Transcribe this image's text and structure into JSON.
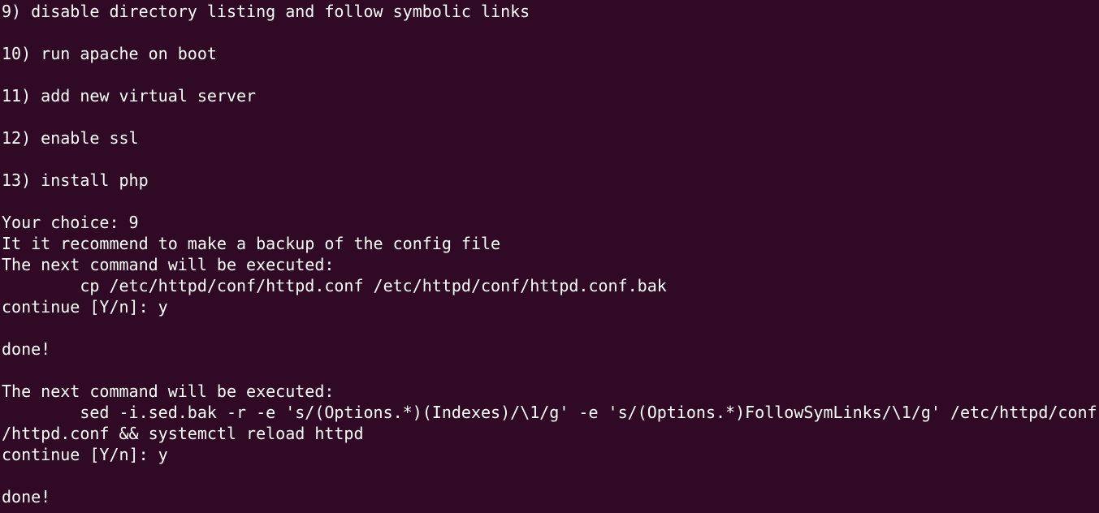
{
  "terminal": {
    "background": "#300a24",
    "foreground": "#ffffff",
    "lines": [
      "9) disable directory listing and follow symbolic links",
      "",
      "10) run apache on boot",
      "",
      "11) add new virtual server",
      "",
      "12) enable ssl",
      "",
      "13) install php",
      "",
      "Your choice: 9",
      "It it recommend to make a backup of the config file",
      "The next command will be executed:",
      "        cp /etc/httpd/conf/httpd.conf /etc/httpd/conf/httpd.conf.bak",
      "continue [Y/n]: y",
      "",
      "done!",
      "",
      "The next command will be executed:",
      "        sed -i.sed.bak -r -e 's/(Options.*)(Indexes)/\\1/g' -e 's/(Options.*)FollowSymLinks/\\1/g' /etc/httpd/conf",
      "/httpd.conf && systemctl reload httpd",
      "continue [Y/n]: y",
      "",
      "done!"
    ]
  }
}
